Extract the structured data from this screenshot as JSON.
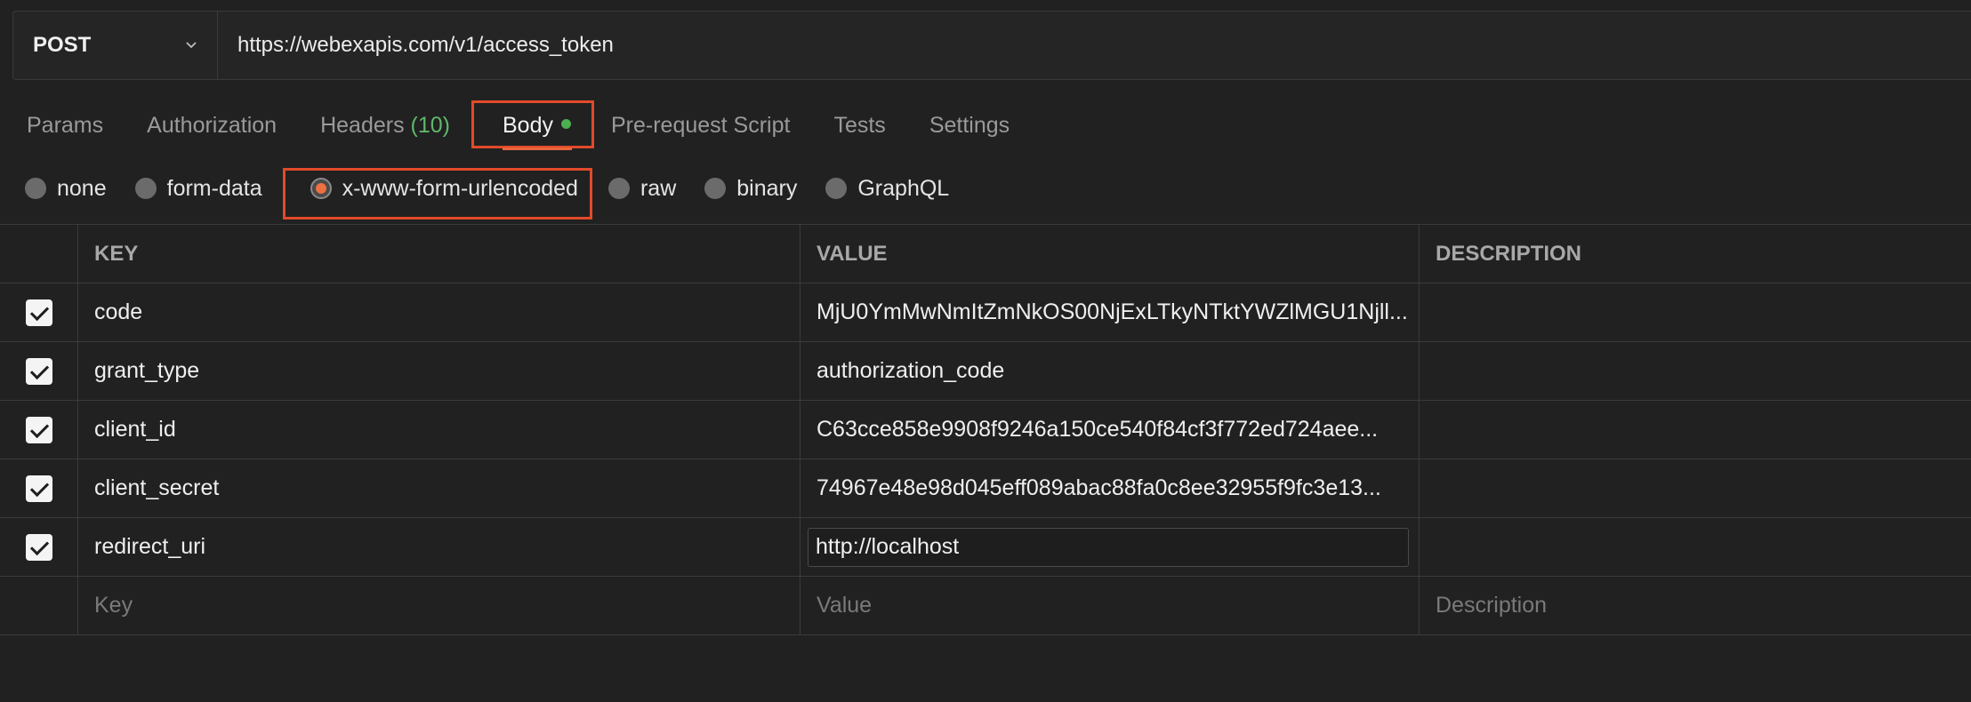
{
  "request": {
    "method": "POST",
    "url": "https://webexapis.com/v1/access_token"
  },
  "tabs": [
    {
      "label": "Params"
    },
    {
      "label": "Authorization"
    },
    {
      "label": "Headers",
      "count": "(10)"
    },
    {
      "label": "Body",
      "active": true
    },
    {
      "label": "Pre-request Script"
    },
    {
      "label": "Tests"
    },
    {
      "label": "Settings"
    }
  ],
  "body_types": [
    {
      "label": "none"
    },
    {
      "label": "form-data"
    },
    {
      "label": "x-www-form-urlencoded",
      "selected": true
    },
    {
      "label": "raw"
    },
    {
      "label": "binary"
    },
    {
      "label": "GraphQL"
    }
  ],
  "table": {
    "headers": {
      "key": "KEY",
      "value": "VALUE",
      "description": "DESCRIPTION"
    },
    "rows": [
      {
        "checked": true,
        "key": "code",
        "value": "MjU0YmMwNmItZmNkOS00NjExLTkyNTktYWZlMGU1Njll..."
      },
      {
        "checked": true,
        "key": "grant_type",
        "value": "authorization_code"
      },
      {
        "checked": true,
        "key": "client_id",
        "value": "C63cce858e9908f9246a150ce540f84cf3f772ed724aee..."
      },
      {
        "checked": true,
        "key": "client_secret",
        "value": "74967e48e98d045eff089abac88fa0c8ee32955f9fc3e13..."
      },
      {
        "checked": true,
        "key": "redirect_uri",
        "value": "http://localhost"
      }
    ],
    "placeholders": {
      "key": "Key",
      "value": "Value",
      "description": "Description"
    }
  },
  "colors": {
    "highlight_box": "#e24a2a",
    "active_dot": "#4caf50",
    "headers_count": "#5fb86a",
    "radio_selected": "#ee6f3f"
  }
}
